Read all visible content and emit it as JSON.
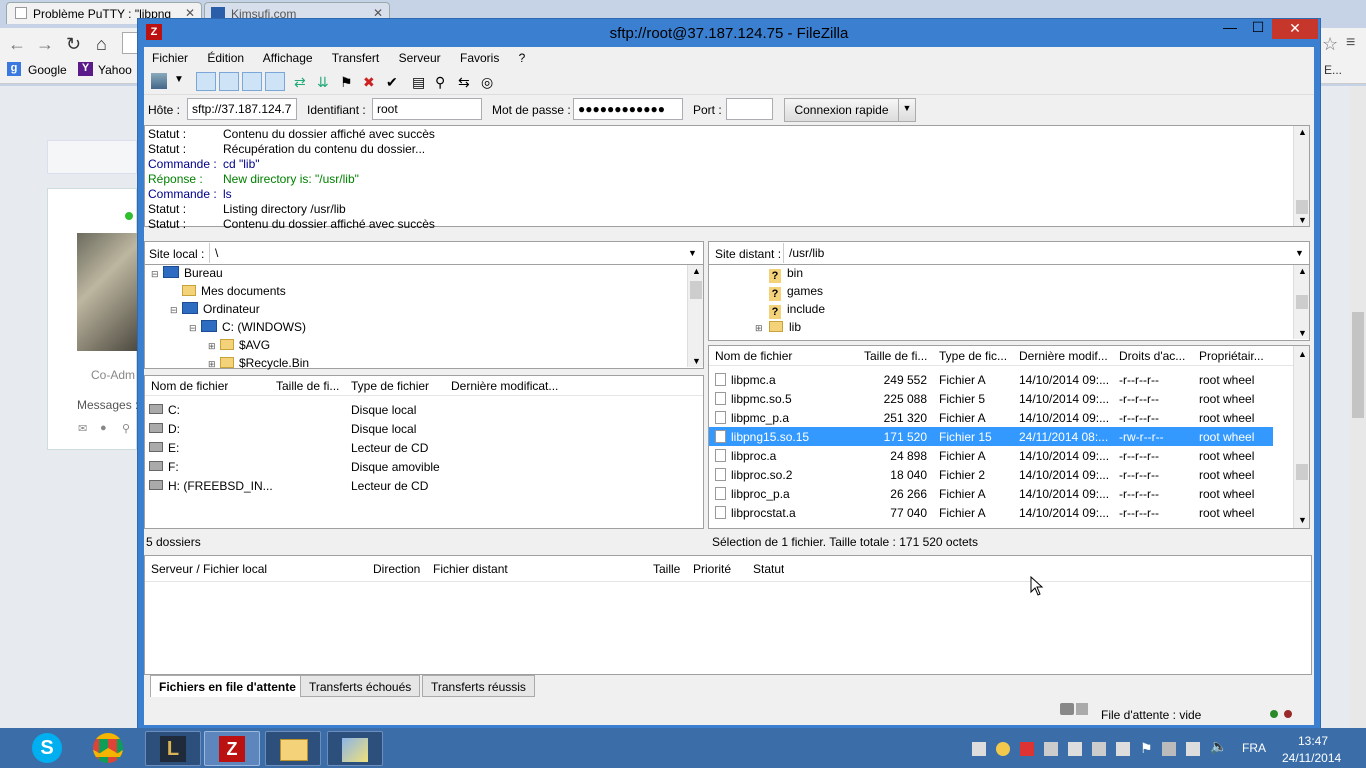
{
  "browser": {
    "tabs": [
      "Problème PuTTY : \"libpng",
      "Kimsufi.com"
    ],
    "bookmarks": [
      "Google",
      "Yahoo"
    ],
    "side_text": {
      "coadmin": "Co-Adm",
      "messages": "Messages :"
    },
    "ext_text": "E..."
  },
  "filezilla": {
    "title": "sftp://root@37.187.124.75 - FileZilla",
    "menu": [
      "Fichier",
      "Édition",
      "Affichage",
      "Transfert",
      "Serveur",
      "Favoris",
      "?"
    ],
    "quickconnect": {
      "host_label": "Hôte :",
      "host_value": "sftp://37.187.124.75",
      "user_label": "Identifiant :",
      "user_value": "root",
      "pass_label": "Mot de passe :",
      "pass_value": "●●●●●●●●●●●●",
      "port_label": "Port :",
      "port_value": "",
      "connect_label": "Connexion rapide"
    },
    "log": [
      {
        "key": "Statut :",
        "msg": "Contenu du dossier affiché avec succès",
        "color": "#000000"
      },
      {
        "key": "Statut :",
        "msg": "Récupération du contenu du dossier...",
        "color": "#000000"
      },
      {
        "key": "Commande :",
        "msg": "cd \"lib\"",
        "color": "#00008b"
      },
      {
        "key": "Réponse :",
        "msg": "New directory is: \"/usr/lib\"",
        "color": "#008000"
      },
      {
        "key": "Commande :",
        "msg": "ls",
        "color": "#00008b"
      },
      {
        "key": "Statut :",
        "msg": "Listing directory /usr/lib",
        "color": "#000000"
      },
      {
        "key": "Statut :",
        "msg": "Contenu du dossier affiché avec succès",
        "color": "#000000"
      }
    ],
    "local": {
      "site_label": "Site local :",
      "site_value": "\\",
      "tree": [
        {
          "label": "Bureau",
          "indent": 0
        },
        {
          "label": "Mes documents",
          "indent": 1
        },
        {
          "label": "Ordinateur",
          "indent": 1
        },
        {
          "label": "C: (WINDOWS)",
          "indent": 2
        },
        {
          "label": "$AVG",
          "indent": 3
        },
        {
          "label": "$Recycle.Bin",
          "indent": 3
        }
      ],
      "columns": [
        "Nom de fichier",
        "Taille de fi...",
        "Type de fichier",
        "Dernière modificat..."
      ],
      "files": [
        {
          "name": "C:",
          "type": "Disque local"
        },
        {
          "name": "D:",
          "type": "Disque local"
        },
        {
          "name": "E:",
          "type": "Lecteur de CD"
        },
        {
          "name": "F:",
          "type": "Disque amovible"
        },
        {
          "name": "H: (FREEBSD_IN...",
          "type": "Lecteur de CD"
        }
      ],
      "status": "5 dossiers"
    },
    "remote": {
      "site_label": "Site distant :",
      "site_value": "/usr/lib",
      "tree": [
        "bin",
        "games",
        "include",
        "lib"
      ],
      "columns": [
        "Nom de fichier",
        "Taille de fi...",
        "Type de fic...",
        "Dernière modif...",
        "Droits d'ac...",
        "Propriétair..."
      ],
      "files": [
        {
          "name": "libpmc.a",
          "size": "249 552",
          "type": "Fichier A",
          "date": "14/10/2014 09:...",
          "perm": "-r--r--r--",
          "owner": "root wheel",
          "selected": false
        },
        {
          "name": "libpmc.so.5",
          "size": "225 088",
          "type": "Fichier 5",
          "date": "14/10/2014 09:...",
          "perm": "-r--r--r--",
          "owner": "root wheel",
          "selected": false
        },
        {
          "name": "libpmc_p.a",
          "size": "251 320",
          "type": "Fichier A",
          "date": "14/10/2014 09:...",
          "perm": "-r--r--r--",
          "owner": "root wheel",
          "selected": false
        },
        {
          "name": "libpng15.so.15",
          "size": "171 520",
          "type": "Fichier 15",
          "date": "24/11/2014 08:...",
          "perm": "-rw-r--r--",
          "owner": "root wheel",
          "selected": true
        },
        {
          "name": "libproc.a",
          "size": "24 898",
          "type": "Fichier A",
          "date": "14/10/2014 09:...",
          "perm": "-r--r--r--",
          "owner": "root wheel",
          "selected": false
        },
        {
          "name": "libproc.so.2",
          "size": "18 040",
          "type": "Fichier 2",
          "date": "14/10/2014 09:...",
          "perm": "-r--r--r--",
          "owner": "root wheel",
          "selected": false
        },
        {
          "name": "libproc_p.a",
          "size": "26 266",
          "type": "Fichier A",
          "date": "14/10/2014 09:...",
          "perm": "-r--r--r--",
          "owner": "root wheel",
          "selected": false
        },
        {
          "name": "libprocstat.a",
          "size": "77 040",
          "type": "Fichier A",
          "date": "14/10/2014 09:...",
          "perm": "-r--r--r--",
          "owner": "root wheel",
          "selected": false
        }
      ],
      "status": "Sélection de 1 fichier. Taille totale : 171 520 octets"
    },
    "queue": {
      "columns": [
        "Serveur / Fichier local",
        "Direction",
        "Fichier distant",
        "Taille",
        "Priorité",
        "Statut"
      ],
      "tabs": [
        "Fichiers en file d'attente",
        "Transferts échoués",
        "Transferts réussis"
      ]
    },
    "bottom_status": "File d'attente : vide"
  },
  "taskbar": {
    "lang": "FRA",
    "time": "13:47",
    "date": "24/11/2014"
  },
  "colors": {
    "accent": "#3b7fd0",
    "selection": "#3399ff",
    "taskbar": "#3b6ea8"
  }
}
